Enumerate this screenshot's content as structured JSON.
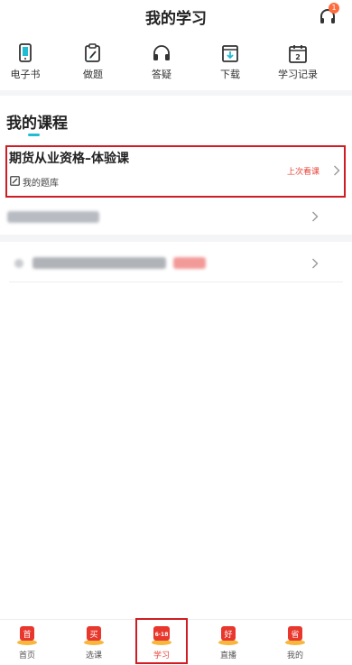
{
  "header": {
    "title": "我的学习",
    "support_badge": "1"
  },
  "quick_actions": [
    {
      "label": "电子书",
      "icon": "phone-icon"
    },
    {
      "label": "做题",
      "icon": "edit-icon"
    },
    {
      "label": "答疑",
      "icon": "headset-icon"
    },
    {
      "label": "下载",
      "icon": "download-icon"
    },
    {
      "label": "学习记录",
      "icon": "calendar-icon"
    }
  ],
  "calendar_day": "2",
  "section": {
    "title": "我的课程"
  },
  "course": {
    "title": "期货从业资格–体验课",
    "question_bank": "我的题库",
    "last_watched": "上次看课"
  },
  "tabbar": {
    "items": [
      {
        "label": "首页",
        "badge": "首"
      },
      {
        "label": "选课",
        "badge": "买"
      },
      {
        "label": "学习",
        "badge": "6·18"
      },
      {
        "label": "直播",
        "badge": "好"
      },
      {
        "label": "我的",
        "badge": "省"
      }
    ],
    "active": "学习"
  },
  "colors": {
    "accent": "#1fbcd2",
    "highlight_red": "#cf1d24",
    "last_watched": "#e6453a",
    "badge": "#ff6b3d"
  }
}
